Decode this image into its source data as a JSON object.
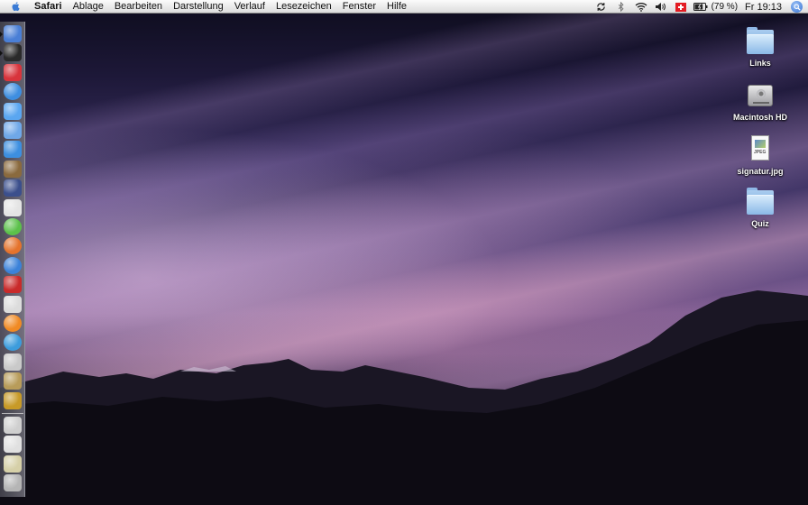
{
  "menubar": {
    "apple_icon": "apple-icon",
    "app_name": "Safari",
    "menus": [
      "Ablage",
      "Bearbeiten",
      "Darstellung",
      "Verlauf",
      "Lesezeichen",
      "Fenster",
      "Hilfe"
    ],
    "status": {
      "icons": [
        "sync-icon",
        "bluetooth-icon",
        "wifi-icon",
        "volume-icon",
        "input-flag-icon",
        "battery-icon"
      ],
      "battery_text": "(79 %)",
      "battery_level": 0.79,
      "clock": "Fr 19:13",
      "spotlight_icon": "spotlight-icon"
    }
  },
  "dock": {
    "items": [
      {
        "name": "finder",
        "color": "#4a7fd6",
        "running": true
      },
      {
        "name": "dvd-player",
        "color": "#2a2a2a",
        "running": true
      },
      {
        "name": "ical",
        "color": "#d8343c",
        "running": false
      },
      {
        "name": "safari",
        "color": "#3e8ee0",
        "running": false
      },
      {
        "name": "ichat",
        "color": "#5aa6f0",
        "running": false
      },
      {
        "name": "itunes",
        "color": "#6fa8e8",
        "running": false
      },
      {
        "name": "iweb",
        "color": "#3d8fe0",
        "running": false
      },
      {
        "name": "iphoto",
        "color": "#8a6a3e",
        "running": false
      },
      {
        "name": "imovie",
        "color": "#3b4f8c",
        "running": false
      },
      {
        "name": "textedit",
        "color": "#e4e4e4",
        "running": false
      },
      {
        "name": "facetime-green",
        "color": "#5bc14a",
        "running": false
      },
      {
        "name": "firefox",
        "color": "#e5732c",
        "running": false
      },
      {
        "name": "quicktime",
        "color": "#3b82d9",
        "running": false
      },
      {
        "name": "photo-booth",
        "color": "#c92a2a",
        "running": false
      },
      {
        "name": "preview",
        "color": "#dcdcdc",
        "running": false
      },
      {
        "name": "blender",
        "color": "#f08a24",
        "running": false
      },
      {
        "name": "network",
        "color": "#3c9cdc",
        "running": false
      },
      {
        "name": "x11",
        "color": "#c9c9c9",
        "running": false
      },
      {
        "name": "pen-tool",
        "color": "#b89c5a",
        "running": false
      },
      {
        "name": "warcraft",
        "color": "#c79a28",
        "running": false
      },
      {
        "name": "applications-stack",
        "color": "#cfcfcf",
        "running": false
      },
      {
        "name": "documents-stack",
        "color": "#e0e0e0",
        "running": false
      },
      {
        "name": "downloads-stack",
        "color": "#d6d0a8",
        "running": false
      },
      {
        "name": "trash",
        "color": "#b5b5b5",
        "running": false
      }
    ]
  },
  "desktop": {
    "icons": [
      {
        "label": "Links",
        "type": "folder"
      },
      {
        "label": "Macintosh HD",
        "type": "hard-drive"
      },
      {
        "label": "signatur.jpg",
        "type": "jpeg",
        "badge": "JPEG"
      },
      {
        "label": "Quiz",
        "type": "folder"
      }
    ]
  }
}
